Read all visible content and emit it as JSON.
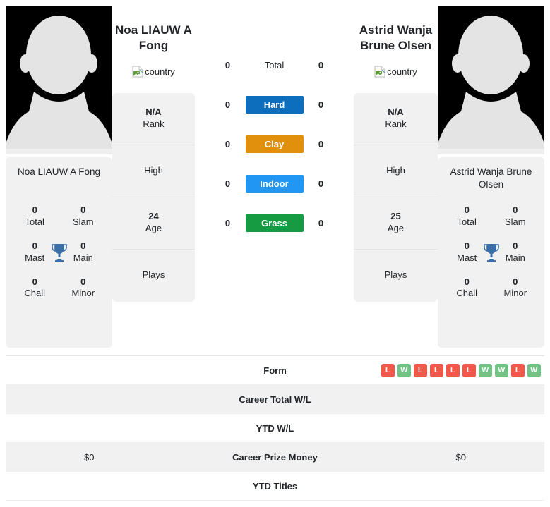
{
  "players": {
    "left": {
      "display_name": "Noa LIAUW A Fong",
      "header_name": "Noa LIAUW A Fong",
      "country_alt": "country",
      "photo_alt": "player-photo",
      "titles": [
        {
          "value": "0",
          "label": "Total"
        },
        {
          "value": "0",
          "label": "Slam"
        },
        {
          "value": "0",
          "label": "Mast"
        },
        {
          "value": "0",
          "label": "Main"
        },
        {
          "value": "0",
          "label": "Chall"
        },
        {
          "value": "0",
          "label": "Minor"
        }
      ],
      "info": [
        {
          "value": "N/A",
          "label": "Rank"
        },
        {
          "value": "",
          "label": "High"
        },
        {
          "value": "24",
          "label": "Age"
        },
        {
          "value": "",
          "label": "Plays"
        }
      ],
      "career_prize_money": "$0",
      "career_total_wl": "",
      "ytd_wl": "",
      "ytd_titles": "",
      "form": []
    },
    "right": {
      "display_name": "Astrid Wanja Brune Olsen",
      "header_name": "Astrid Wanja Brune Olsen",
      "country_alt": "country",
      "photo_alt": "player-photo",
      "titles": [
        {
          "value": "0",
          "label": "Total"
        },
        {
          "value": "0",
          "label": "Slam"
        },
        {
          "value": "0",
          "label": "Mast"
        },
        {
          "value": "0",
          "label": "Main"
        },
        {
          "value": "0",
          "label": "Chall"
        },
        {
          "value": "0",
          "label": "Minor"
        }
      ],
      "info": [
        {
          "value": "N/A",
          "label": "Rank"
        },
        {
          "value": "",
          "label": "High"
        },
        {
          "value": "25",
          "label": "Age"
        },
        {
          "value": "",
          "label": "Plays"
        }
      ],
      "career_prize_money": "$0",
      "career_total_wl": "",
      "ytd_wl": "",
      "ytd_titles": "",
      "form": [
        "L",
        "W",
        "L",
        "L",
        "L",
        "L",
        "W",
        "W",
        "L",
        "W"
      ]
    }
  },
  "h2h": [
    {
      "surface": "Total",
      "left": "0",
      "right": "0",
      "color": "",
      "plain": true
    },
    {
      "surface": "Hard",
      "left": "0",
      "right": "0",
      "color": "#0d6ebd",
      "plain": false
    },
    {
      "surface": "Clay",
      "left": "0",
      "right": "0",
      "color": "#e0900d",
      "plain": false
    },
    {
      "surface": "Indoor",
      "left": "0",
      "right": "0",
      "color": "#2196f3",
      "plain": false
    },
    {
      "surface": "Grass",
      "left": "0",
      "right": "0",
      "color": "#169b42",
      "plain": false
    }
  ],
  "table_rows": [
    {
      "label": "Form",
      "left": "",
      "right": "",
      "shaded": false,
      "type": "form"
    },
    {
      "label": "Career Total W/L",
      "left": "",
      "right": "",
      "shaded": true,
      "type": "text"
    },
    {
      "label": "YTD W/L",
      "left": "",
      "right": "",
      "shaded": false,
      "type": "text"
    },
    {
      "label": "Career Prize Money",
      "left": "$0",
      "right": "$0",
      "shaded": true,
      "type": "text"
    },
    {
      "label": "YTD Titles",
      "left": "",
      "right": "",
      "shaded": false,
      "type": "text"
    }
  ],
  "colors": {
    "card_bg": "#f1f1f1",
    "win": "#72c285",
    "loss": "#f0584a",
    "trophy": "#3b6fa8",
    "photo_bg": "#000000"
  }
}
